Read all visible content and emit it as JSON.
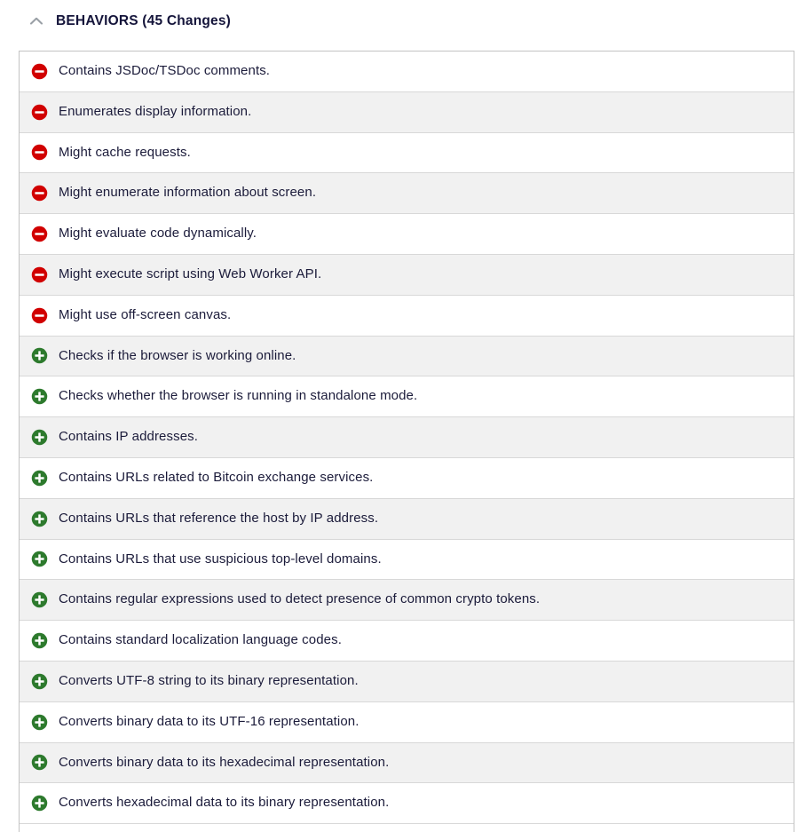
{
  "header": {
    "collapse_icon": "chevron-up-icon",
    "title": "BEHAVIORS (45 Changes)",
    "expanded": true
  },
  "colors": {
    "removed": "#d10000",
    "added": "#2d7a2d",
    "text": "#1b1b3a",
    "border": "#c3c3c3",
    "row_alt_bg": "#f1f1f1",
    "row_bg": "#ffffff",
    "chevron": "#9aa0a6"
  },
  "legend": {
    "removed_icon": "minus-circle-icon",
    "added_icon": "plus-circle-icon"
  },
  "behaviors": [
    {
      "change": "removed",
      "icon": "minus-circle-icon",
      "label": "Contains JSDoc/TSDoc comments."
    },
    {
      "change": "removed",
      "icon": "minus-circle-icon",
      "label": "Enumerates display information."
    },
    {
      "change": "removed",
      "icon": "minus-circle-icon",
      "label": "Might cache requests."
    },
    {
      "change": "removed",
      "icon": "minus-circle-icon",
      "label": "Might enumerate information about screen."
    },
    {
      "change": "removed",
      "icon": "minus-circle-icon",
      "label": "Might evaluate code dynamically."
    },
    {
      "change": "removed",
      "icon": "minus-circle-icon",
      "label": "Might execute script using Web Worker API."
    },
    {
      "change": "removed",
      "icon": "minus-circle-icon",
      "label": "Might use off-screen canvas."
    },
    {
      "change": "added",
      "icon": "plus-circle-icon",
      "label": "Checks if the browser is working online."
    },
    {
      "change": "added",
      "icon": "plus-circle-icon",
      "label": "Checks whether the browser is running in standalone mode."
    },
    {
      "change": "added",
      "icon": "plus-circle-icon",
      "label": "Contains IP addresses."
    },
    {
      "change": "added",
      "icon": "plus-circle-icon",
      "label": "Contains URLs related to Bitcoin exchange services."
    },
    {
      "change": "added",
      "icon": "plus-circle-icon",
      "label": "Contains URLs that reference the host by IP address."
    },
    {
      "change": "added",
      "icon": "plus-circle-icon",
      "label": "Contains URLs that use suspicious top-level domains."
    },
    {
      "change": "added",
      "icon": "plus-circle-icon",
      "label": "Contains regular expressions used to detect presence of common crypto tokens."
    },
    {
      "change": "added",
      "icon": "plus-circle-icon",
      "label": "Contains standard localization language codes."
    },
    {
      "change": "added",
      "icon": "plus-circle-icon",
      "label": "Converts UTF-8 string to its binary representation."
    },
    {
      "change": "added",
      "icon": "plus-circle-icon",
      "label": "Converts binary data to its UTF-16 representation."
    },
    {
      "change": "added",
      "icon": "plus-circle-icon",
      "label": "Converts binary data to its hexadecimal representation."
    },
    {
      "change": "added",
      "icon": "plus-circle-icon",
      "label": "Converts hexadecimal data to its binary representation."
    }
  ]
}
